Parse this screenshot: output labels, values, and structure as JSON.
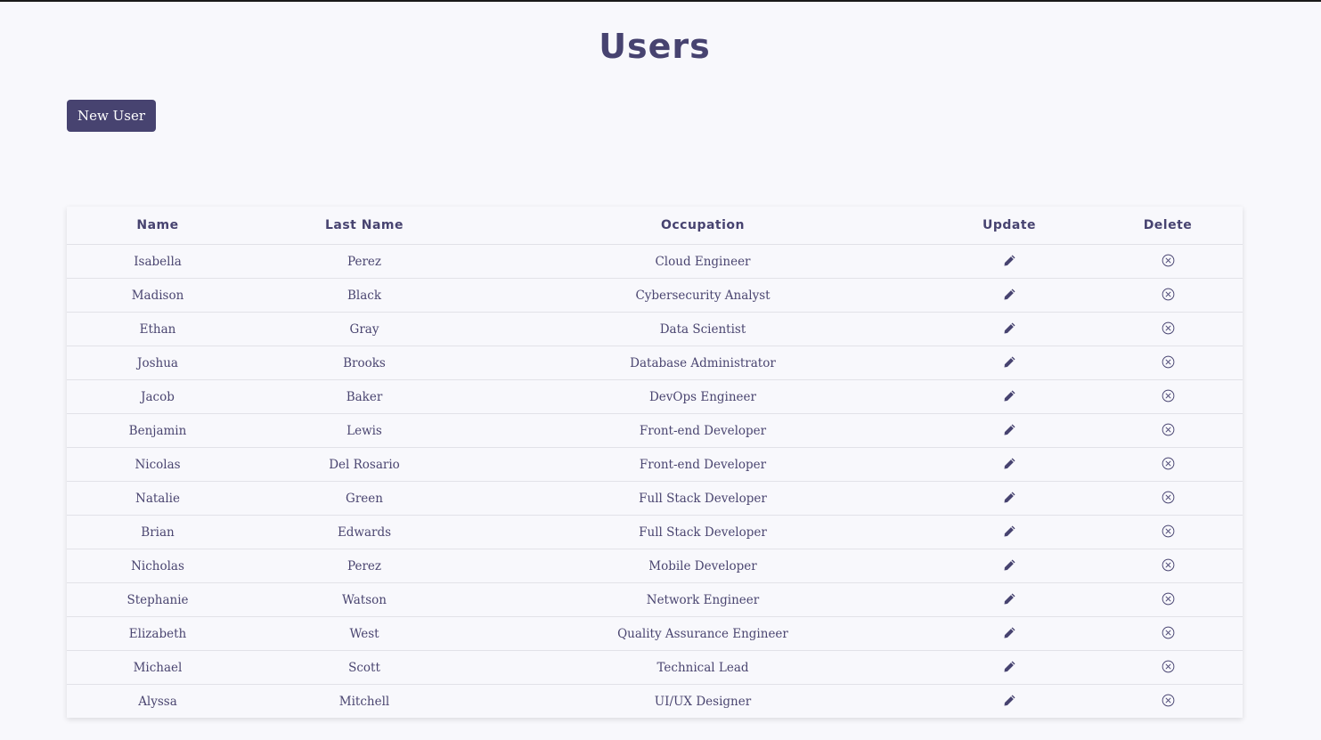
{
  "page": {
    "title": "Users"
  },
  "toolbar": {
    "new_user_label": "New User"
  },
  "colors": {
    "primary": "#474370",
    "background": "#f8f8fc"
  },
  "table": {
    "headers": {
      "name": "Name",
      "last_name": "Last Name",
      "occupation": "Occupation",
      "update": "Update",
      "delete": "Delete"
    },
    "update_icon": "pencil-icon",
    "delete_icon": "circle-x-icon",
    "rows": [
      {
        "name": "Isabella",
        "last_name": "Perez",
        "occupation": "Cloud Engineer"
      },
      {
        "name": "Madison",
        "last_name": "Black",
        "occupation": "Cybersecurity Analyst"
      },
      {
        "name": "Ethan",
        "last_name": "Gray",
        "occupation": "Data Scientist"
      },
      {
        "name": "Joshua",
        "last_name": "Brooks",
        "occupation": "Database Administrator"
      },
      {
        "name": "Jacob",
        "last_name": "Baker",
        "occupation": "DevOps Engineer"
      },
      {
        "name": "Benjamin",
        "last_name": "Lewis",
        "occupation": "Front-end Developer"
      },
      {
        "name": "Nicolas",
        "last_name": "Del Rosario",
        "occupation": "Front-end Developer"
      },
      {
        "name": "Natalie",
        "last_name": "Green",
        "occupation": "Full Stack Developer"
      },
      {
        "name": "Brian",
        "last_name": "Edwards",
        "occupation": "Full Stack Developer"
      },
      {
        "name": "Nicholas",
        "last_name": "Perez",
        "occupation": "Mobile Developer"
      },
      {
        "name": "Stephanie",
        "last_name": "Watson",
        "occupation": "Network Engineer"
      },
      {
        "name": "Elizabeth",
        "last_name": "West",
        "occupation": "Quality Assurance Engineer"
      },
      {
        "name": "Michael",
        "last_name": "Scott",
        "occupation": "Technical Lead"
      },
      {
        "name": "Alyssa",
        "last_name": "Mitchell",
        "occupation": "UI/UX Designer"
      }
    ]
  }
}
